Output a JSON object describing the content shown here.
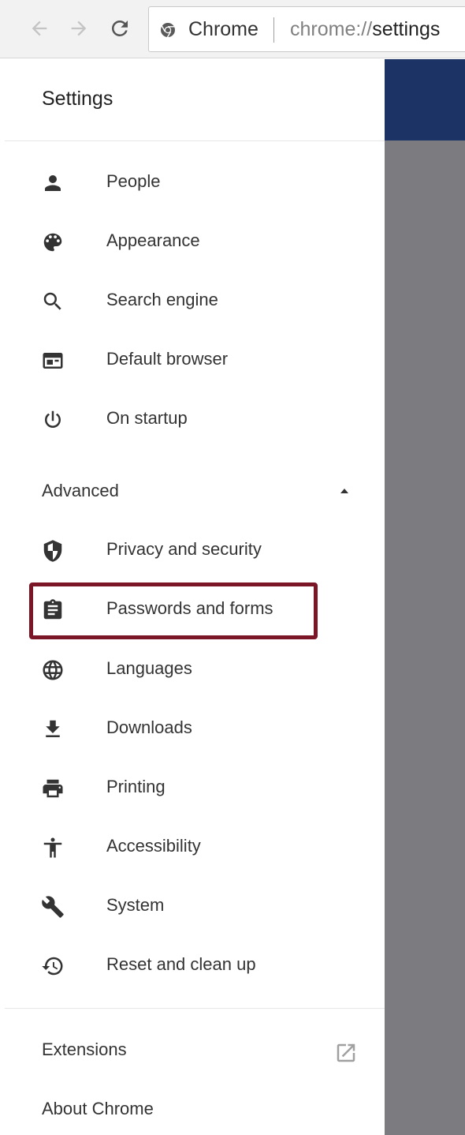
{
  "browser": {
    "omnibox": {
      "chip_label": "Chrome",
      "url_scheme": "chrome://",
      "url_host": "settings"
    }
  },
  "drawer": {
    "title": "Settings",
    "main_items": [
      {
        "label": "People",
        "icon": "person-icon"
      },
      {
        "label": "Appearance",
        "icon": "palette-icon"
      },
      {
        "label": "Search engine",
        "icon": "search-icon"
      },
      {
        "label": "Default browser",
        "icon": "browser-window-icon"
      },
      {
        "label": "On startup",
        "icon": "power-icon"
      }
    ],
    "advanced": {
      "label": "Advanced",
      "expanded": true
    },
    "advanced_items": [
      {
        "label": "Privacy and security",
        "icon": "shield-icon"
      },
      {
        "label": "Passwords and forms",
        "icon": "clipboard-icon",
        "highlighted": true
      },
      {
        "label": "Languages",
        "icon": "globe-icon"
      },
      {
        "label": "Downloads",
        "icon": "download-icon"
      },
      {
        "label": "Printing",
        "icon": "printer-icon"
      },
      {
        "label": "Accessibility",
        "icon": "accessibility-icon"
      },
      {
        "label": "System",
        "icon": "wrench-icon"
      },
      {
        "label": "Reset and clean up",
        "icon": "restore-icon"
      }
    ],
    "footer": {
      "extensions_label": "Extensions",
      "about_label": "About Chrome"
    }
  },
  "colors": {
    "header_blue": "#1c3366",
    "scrim_gray": "#7b7b80",
    "highlight_border": "#7a1626",
    "icon_color": "#333333"
  }
}
